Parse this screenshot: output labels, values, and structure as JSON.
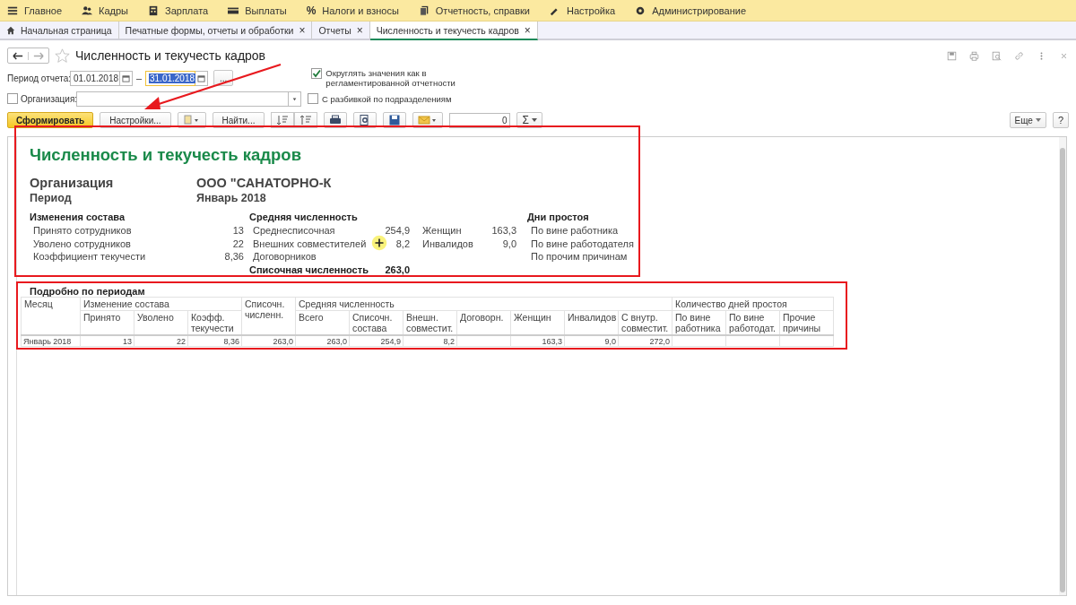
{
  "menu": [
    {
      "label": "Главное"
    },
    {
      "label": "Кадры"
    },
    {
      "label": "Зарплата"
    },
    {
      "label": "Выплаты"
    },
    {
      "label": "Налоги и взносы",
      "glyph": "%"
    },
    {
      "label": "Отчетность, справки"
    },
    {
      "label": "Настройка"
    },
    {
      "label": "Администрирование"
    }
  ],
  "tabs": [
    {
      "label": "Начальная страница",
      "selected": false,
      "closable": false
    },
    {
      "label": "Печатные формы, отчеты и обработки",
      "selected": false,
      "closable": true
    },
    {
      "label": "Отчеты",
      "selected": false,
      "closable": true
    },
    {
      "label": "Численность и текучесть кадров",
      "selected": true,
      "closable": true
    }
  ],
  "close_glyph": "×",
  "form": {
    "title": "Численность и текучесть кадров",
    "favorite": false,
    "period_label": "Период отчета:",
    "date_from": "01.01.2018",
    "dash": "–",
    "date_to": "31.01.2018",
    "more_button": "...",
    "round_checkbox": {
      "label": "Округлять значения как в регламентированной отчетности",
      "checked": true
    },
    "org_checkbox": {
      "label": "Организация:",
      "checked": false
    },
    "split_checkbox": {
      "label": "С разбивкой по подразделениям",
      "checked": false
    },
    "generate_button": "Сформировать",
    "settings_button": "Настройки...",
    "find_button": "Найти...",
    "sum_value": "0",
    "sum_glyph": "Σ",
    "more_menu": "Еще",
    "help_button": "?"
  },
  "report": {
    "title": "Численность и текучесть кадров",
    "organization": {
      "label": "Организация",
      "value": "ООО \"САНАТОРНО-К"
    },
    "period": {
      "label": "Период",
      "value": "Январь 2018"
    },
    "changes": {
      "heading": "Изменения состава",
      "rows": [
        {
          "label": "Принято сотрудников",
          "value": "13"
        },
        {
          "label": "Уволено сотрудников",
          "value": "22"
        },
        {
          "label": "Коэффициент текучести",
          "value": "8,36"
        }
      ]
    },
    "average": {
      "heading": "Средняя численность",
      "rows": [
        {
          "label": "Среднесписочная",
          "value": "254,9",
          "label_2": "Женщин",
          "value_2": "163,3"
        },
        {
          "label": "Внешних совместителей",
          "value": "8,2",
          "label_2": "Инвалидов",
          "value_2": "9,0"
        },
        {
          "label": "Договорников"
        }
      ],
      "total": {
        "label": "Списочная численность",
        "value": "263,0"
      }
    },
    "downtime": {
      "heading": "Дни простоя",
      "rows": [
        "По вине работника",
        "По вине работодателя",
        "По прочим причинам"
      ]
    },
    "details_heading": "Подробно по периодам",
    "table": {
      "groups": [
        "Месяц",
        "Изменение состава",
        "Списочн. численн.",
        "Средняя численность",
        "Количество дней простоя"
      ],
      "columns": [
        "",
        "Принято",
        "Уволено",
        "Коэфф. текучести",
        "",
        "Всего",
        "Списочн. состава",
        "Внешн. совместит.",
        "Договорн.",
        "Женщин",
        "Инвалидов",
        "С внутр. совместит.",
        "По вине работника",
        "По вине работодат.",
        "Прочие причины"
      ],
      "rows": [
        [
          "Январь 2018",
          "13",
          "22",
          "8,36",
          "263,0",
          "263,0",
          "254,9",
          "8,2",
          "",
          "163,3",
          "9,0",
          "272,0",
          "",
          "",
          ""
        ]
      ]
    }
  },
  "annotations": [
    {
      "kind": "frame"
    },
    {
      "kind": "frame"
    },
    {
      "kind": "arrow"
    },
    {
      "kind": "cursor"
    }
  ]
}
